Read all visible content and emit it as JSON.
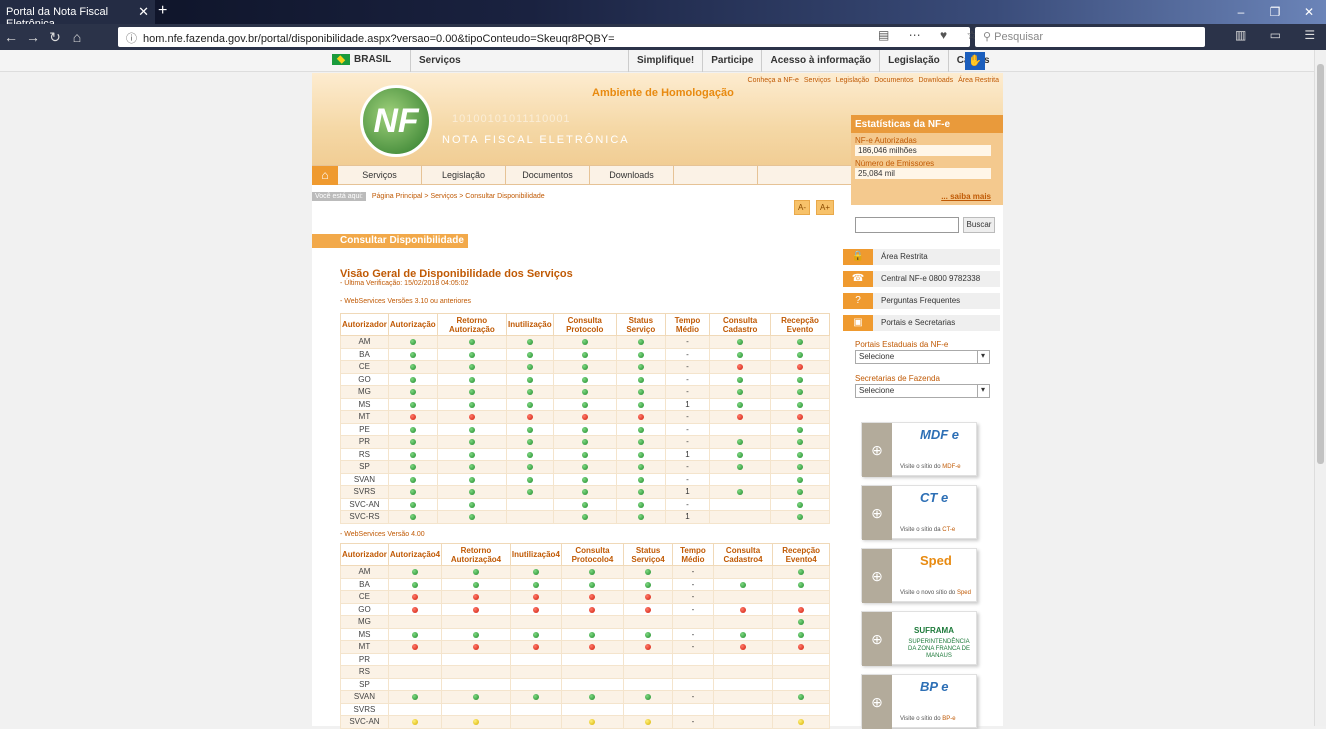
{
  "browser": {
    "tab_title": "Portal da Nota Fiscal Eletrônica",
    "url": "hom.nfe.fazenda.gov.br/portal/disponibilidade.aspx?versao=0.00&tipoConteudo=Skeuqr8PQBY=",
    "search_placeholder": "Pesquisar"
  },
  "govbar": {
    "brasil": "BRASIL",
    "servicos": "Serviços",
    "links": [
      "Simplifique!",
      "Participe",
      "Acesso à informação",
      "Legislação",
      "Canais"
    ]
  },
  "banner": {
    "toplinks": [
      "Conheça a NF-e",
      "Serviços",
      "Legislação",
      "Documentos",
      "Downloads",
      "Área Restrita"
    ],
    "homologacao": "Ambiente de Homologação",
    "logo": "NF e",
    "title": "NOTA FISCAL ELETRÔNICA",
    "binary": "10100101011110001"
  },
  "menu": [
    "Serviços",
    "Legislação",
    "Documentos",
    "Downloads",
    ""
  ],
  "crumb": {
    "here": "Você está aqui:",
    "path": "Página Principal > Serviços > Consultar Disponibilidade"
  },
  "fontbtns": [
    "A-",
    "A+"
  ],
  "section_title": "Consultar Disponibilidade",
  "main_heading": "Visão Geral de Disponibilidade dos Serviços",
  "last_verification": "- Última Verificação: 15/02/2018 04:05:02",
  "ws1": {
    "label": "- WebServices Versões 3.10 ou anteriores",
    "headers": [
      "Autorizador",
      "Autorização",
      "Retorno Autorização",
      "Inutilização",
      "Consulta Protocolo",
      "Status Serviço",
      "Tempo Médio",
      "Consulta Cadastro",
      "Recepção Evento"
    ],
    "rows": [
      [
        "AM",
        "g",
        "g",
        "g",
        "g",
        "g",
        "-",
        "g",
        "g"
      ],
      [
        "BA",
        "g",
        "g",
        "g",
        "g",
        "g",
        "-",
        "g",
        "g"
      ],
      [
        "CE",
        "g",
        "g",
        "g",
        "g",
        "g",
        "-",
        "r",
        "r"
      ],
      [
        "GO",
        "g",
        "g",
        "g",
        "g",
        "g",
        "-",
        "g",
        "g"
      ],
      [
        "MG",
        "g",
        "g",
        "g",
        "g",
        "g",
        "-",
        "g",
        "g"
      ],
      [
        "MS",
        "g",
        "g",
        "g",
        "g",
        "g",
        "1",
        "g",
        "g"
      ],
      [
        "MT",
        "r",
        "r",
        "r",
        "r",
        "r",
        "-",
        "r",
        "r"
      ],
      [
        "PE",
        "g",
        "g",
        "g",
        "g",
        "g",
        "-",
        "",
        "g"
      ],
      [
        "PR",
        "g",
        "g",
        "g",
        "g",
        "g",
        "-",
        "g",
        "g"
      ],
      [
        "RS",
        "g",
        "g",
        "g",
        "g",
        "g",
        "1",
        "g",
        "g"
      ],
      [
        "SP",
        "g",
        "g",
        "g",
        "g",
        "g",
        "-",
        "g",
        "g"
      ],
      [
        "SVAN",
        "g",
        "g",
        "g",
        "g",
        "g",
        "-",
        "",
        "g"
      ],
      [
        "SVRS",
        "g",
        "g",
        "g",
        "g",
        "g",
        "1",
        "g",
        "g"
      ],
      [
        "SVC-AN",
        "g",
        "g",
        "",
        "g",
        "g",
        "-",
        "",
        "g"
      ],
      [
        "SVC-RS",
        "g",
        "g",
        "",
        "g",
        "g",
        "1",
        "",
        "g"
      ]
    ]
  },
  "ws2": {
    "label": "- WebServices Versão 4.00",
    "headers": [
      "Autorizador",
      "Autorização4",
      "Retorno Autorização4",
      "Inutilização4",
      "Consulta Protocolo4",
      "Status Serviço4",
      "Tempo Médio",
      "Consulta Cadastro4",
      "Recepção Evento4"
    ],
    "rows": [
      [
        "AM",
        "g",
        "g",
        "g",
        "g",
        "g",
        "-",
        "",
        "g"
      ],
      [
        "BA",
        "g",
        "g",
        "g",
        "g",
        "g",
        "-",
        "g",
        "g"
      ],
      [
        "CE",
        "r",
        "r",
        "r",
        "r",
        "r",
        "-",
        "",
        ""
      ],
      [
        "GO",
        "r",
        "r",
        "r",
        "r",
        "r",
        "-",
        "r",
        "r"
      ],
      [
        "MG",
        "",
        "",
        "",
        "",
        "",
        "",
        "",
        "g"
      ],
      [
        "MS",
        "g",
        "g",
        "g",
        "g",
        "g",
        "-",
        "g",
        "g"
      ],
      [
        "MT",
        "r",
        "r",
        "r",
        "r",
        "r",
        "-",
        "r",
        "r"
      ],
      [
        "PR",
        "",
        "",
        "",
        "",
        "",
        "",
        "",
        ""
      ],
      [
        "RS",
        "",
        "",
        "",
        "",
        "",
        "",
        "",
        ""
      ],
      [
        "SP",
        "",
        "",
        "",
        "",
        "",
        "",
        "",
        ""
      ],
      [
        "SVAN",
        "g",
        "g",
        "g",
        "g",
        "g",
        "-",
        "",
        "g"
      ],
      [
        "SVRS",
        "",
        "",
        "",
        "",
        "",
        "",
        "",
        ""
      ],
      [
        "SVC-AN",
        "y",
        "y",
        "",
        "y",
        "y",
        "-",
        "",
        "y"
      ]
    ]
  },
  "stats": {
    "title": "Estatísticas da NF-e",
    "aut_label": "NF-e Autorizadas",
    "aut_value": "186,046 milhões",
    "emi_label": "Número de Emissores",
    "emi_value": "25,084 mil",
    "more": "... saiba mais"
  },
  "search_btn": "Buscar",
  "side_items": [
    {
      "icon": "🔒",
      "label": "Área Restrita"
    },
    {
      "icon": "☎",
      "label": "Central NF-e 0800 9782338"
    },
    {
      "icon": "?",
      "label": "Perguntas Frequentes"
    },
    {
      "icon": "▣",
      "label": "Portais e Secretarias"
    }
  ],
  "portais_label": "Portais Estaduais da NF-e",
  "secretarias_label": "Secretarias de Fazenda",
  "select_value": "Selecione",
  "logos": [
    {
      "mark": "MDF e",
      "text": "Visite o sítio do ",
      "link": "MDF-e"
    },
    {
      "mark": "CT e",
      "text": "Visite o sítio da ",
      "link": "CT-e"
    },
    {
      "mark": "Sped",
      "text": "Visite o novo sítio do ",
      "link": "Sped"
    },
    {
      "mark": "SUFRAMA",
      "text": "SUPERINTENDÊNCIA DA ZONA FRANCA DE MANAUS",
      "link": ""
    },
    {
      "mark": "BP e",
      "text": "Visite o sítio do ",
      "link": "BP-e"
    }
  ]
}
